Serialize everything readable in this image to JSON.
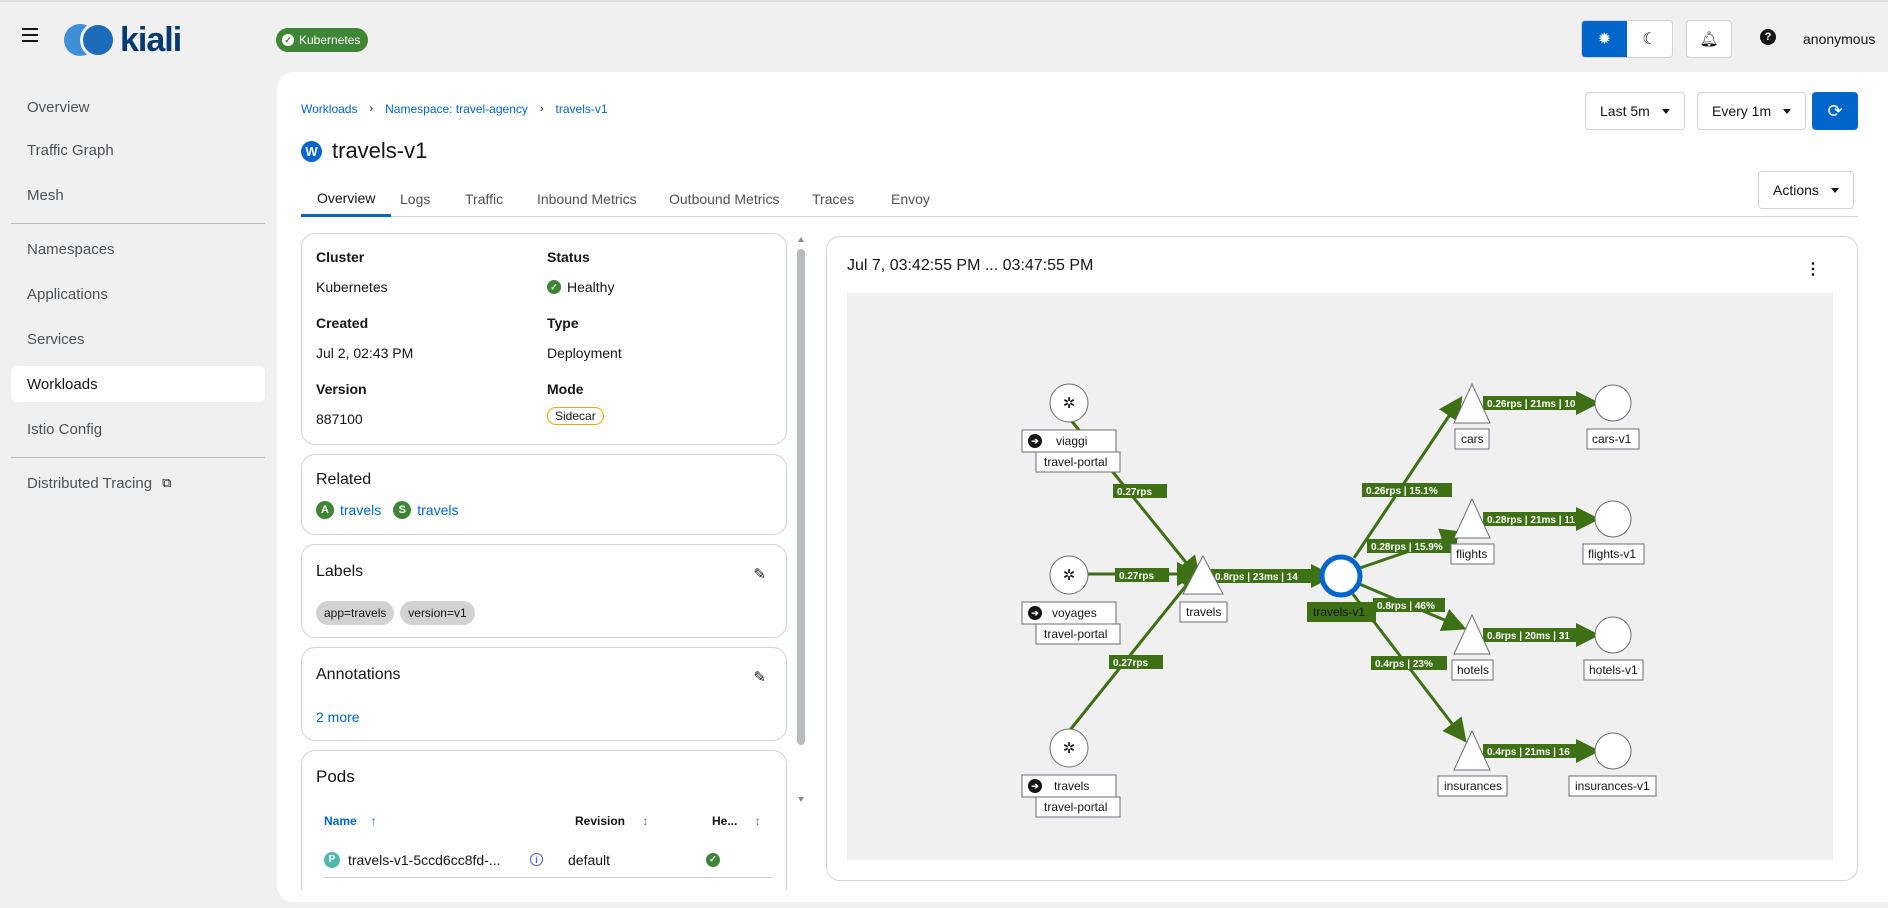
{
  "topbar": {
    "cluster_badge": "Kubernetes",
    "logo_text": "kiali",
    "user": "anonymous",
    "help_icon": "?"
  },
  "sidebar": {
    "items": [
      {
        "label": "Overview"
      },
      {
        "label": "Traffic Graph"
      },
      {
        "label": "Mesh"
      },
      {
        "label": "Namespaces"
      },
      {
        "label": "Applications"
      },
      {
        "label": "Services"
      },
      {
        "label": "Workloads",
        "active": true
      },
      {
        "label": "Istio Config"
      },
      {
        "label": "Distributed Tracing"
      }
    ]
  },
  "header": {
    "breadcrumb": [
      "Workloads",
      "Namespace: travel-agency",
      "travels-v1"
    ],
    "title": "travels-v1",
    "title_badge": "W",
    "duration": "Last 5m",
    "refresh_interval": "Every 1m",
    "actions_label": "Actions"
  },
  "tabs": [
    "Overview",
    "Logs",
    "Traffic",
    "Inbound Metrics",
    "Outbound Metrics",
    "Traces",
    "Envoy"
  ],
  "details": {
    "cluster_label": "Cluster",
    "cluster_value": "Kubernetes",
    "status_label": "Status",
    "status_value": "Healthy",
    "created_label": "Created",
    "created_value": "Jul 2, 02:43 PM",
    "type_label": "Type",
    "type_value": "Deployment",
    "version_label": "Version",
    "version_value": "887100",
    "mode_label": "Mode",
    "mode_value": "Sidecar"
  },
  "related": {
    "title": "Related",
    "items": [
      {
        "badge": "A",
        "label": "travels"
      },
      {
        "badge": "S",
        "label": "travels"
      }
    ]
  },
  "labels": {
    "title": "Labels",
    "chips": [
      "app=travels",
      "version=v1"
    ]
  },
  "annotations": {
    "title": "Annotations",
    "more_link": "2 more"
  },
  "pods": {
    "title": "Pods",
    "columns": [
      "Name",
      "Revision",
      "He..."
    ],
    "rows": [
      {
        "badge": "P",
        "name": "travels-v1-5ccd6cc8fd-...",
        "revision": "default"
      }
    ]
  },
  "graph": {
    "time_range": "Jul 7, 03:42:55 PM ... 03:47:55 PM",
    "nodes": {
      "viaggi": "viaggi",
      "voyages": "voyages",
      "travels_src": "travels",
      "portal": "travel-portal",
      "travels_svc": "travels",
      "travels_v1": "travels-v1",
      "cars": "cars",
      "flights": "flights",
      "hotels": "hotels",
      "insurances": "insurances",
      "cars_v1": "cars-v1",
      "flights_v1": "flights-v1",
      "hotels_v1": "hotels-v1",
      "insurances_v1": "insurances-v1"
    },
    "edges": {
      "viaggi": "0.27rps",
      "voyages": "0.27rps",
      "travels": "0.27rps",
      "to_v1": "0.8rps | 23ms | 14",
      "cars": "0.26rps | 15.1%",
      "flights": "0.28rps | 15.9%",
      "hotels": "0.8rps | 46%",
      "insurances": "0.4rps | 23%",
      "cars_v1": "0.26rps | 21ms | 10",
      "flights_v1": "0.28rps | 21ms | 11",
      "hotels_v1": "0.8rps | 20ms | 31",
      "insurances_v1": "0.4rps | 21ms | 16"
    },
    "colors": {
      "edge": "#3e7115",
      "selected": "#0066cc"
    }
  }
}
